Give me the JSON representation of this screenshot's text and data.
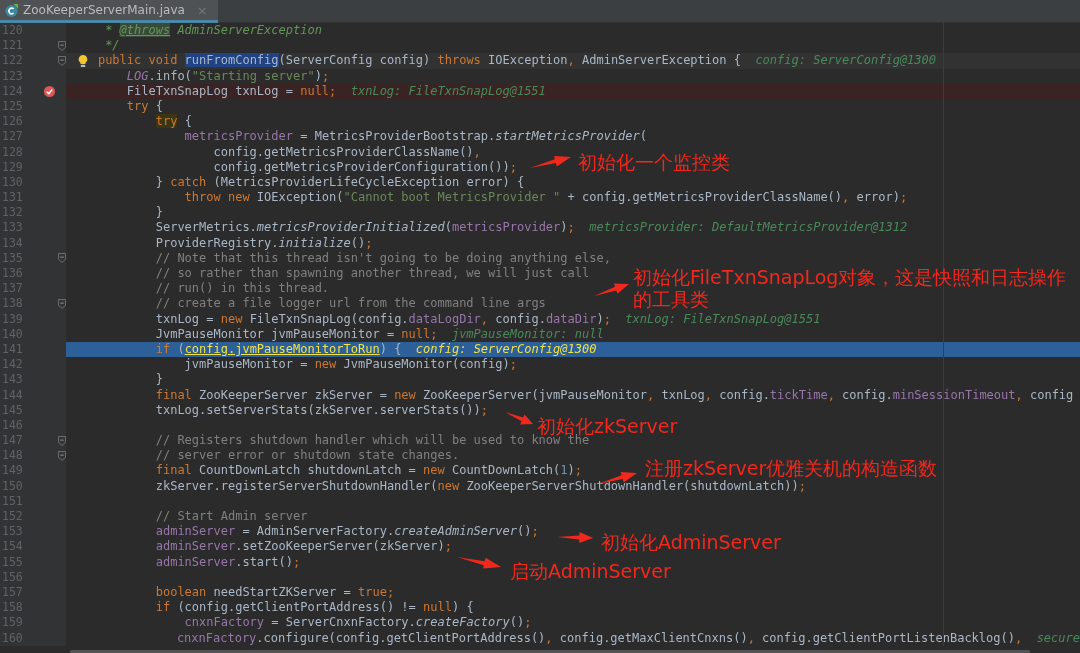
{
  "tabs": [
    {
      "label": "ZooKeeperServerMain.java",
      "close": "×",
      "selected": true
    }
  ],
  "lines": [
    {
      "number": "120",
      "tokens": [
        {
          "kind": "doc",
          "text": "     * "
        },
        {
          "kind": "doc_tag",
          "text": "@throws"
        },
        {
          "kind": "doc",
          "text": " AdminServerException"
        }
      ]
    },
    {
      "number": "121",
      "fold": true,
      "tokens": [
        {
          "kind": "doc",
          "text": "     */"
        }
      ]
    },
    {
      "number": "122",
      "fold": true,
      "caret_line": true,
      "intention_bulb": true,
      "tokens": [
        {
          "kind": "keyword",
          "text": "    public void "
        },
        {
          "kind": "match",
          "text": "runFromConfig"
        },
        {
          "kind": "plain",
          "text": "(ServerConfig config) "
        },
        {
          "kind": "keyword",
          "text": "throws "
        },
        {
          "kind": "plain",
          "text": "IOException"
        },
        {
          "kind": "keyword",
          "text": ", "
        },
        {
          "kind": "plain",
          "text": "AdminServerException {"
        }
      ],
      "hint": "config: ServerConfig@1300"
    },
    {
      "number": "123",
      "tokens": [
        {
          "kind": "static_field",
          "text": "        LOG"
        },
        {
          "kind": "plain",
          "text": ".info("
        },
        {
          "kind": "string",
          "text": "\"Starting server\""
        },
        {
          "kind": "plain",
          "text": ")"
        },
        {
          "kind": "keyword",
          "text": ";"
        }
      ]
    },
    {
      "number": "124",
      "breakpoint": true,
      "tokens": [
        {
          "kind": "plain",
          "text": "        FileTxnSnapLog txnLog = "
        },
        {
          "kind": "keyword",
          "text": "null;"
        }
      ],
      "hint": "txnLog: FileTxnSnapLog@1551"
    },
    {
      "number": "125",
      "tokens": [
        {
          "kind": "keyword",
          "text": "        try "
        },
        {
          "kind": "plain",
          "text": "{"
        }
      ]
    },
    {
      "number": "126",
      "tokens": [
        {
          "kind": "brace_match",
          "text": "            try"
        },
        {
          "kind": "plain",
          "text": " {"
        }
      ]
    },
    {
      "number": "127",
      "tokens": [
        {
          "kind": "field",
          "text": "                metricsProvider"
        },
        {
          "kind": "plain",
          "text": " = MetricsProviderBootstrap."
        },
        {
          "kind": "static",
          "text": "startMetricsProvider"
        },
        {
          "kind": "plain",
          "text": "("
        }
      ]
    },
    {
      "number": "128",
      "tokens": [
        {
          "kind": "plain",
          "text": "                    config.getMetricsProviderClassName()"
        },
        {
          "kind": "keyword",
          "text": ","
        }
      ]
    },
    {
      "number": "129",
      "tokens": [
        {
          "kind": "plain",
          "text": "                    config.getMetricsProviderConfiguration())"
        },
        {
          "kind": "keyword",
          "text": ";"
        }
      ]
    },
    {
      "number": "130",
      "tokens": [
        {
          "kind": "plain",
          "text": "            } "
        },
        {
          "kind": "keyword",
          "text": "catch "
        },
        {
          "kind": "plain",
          "text": "(MetricsProviderLifeCycleException error) {"
        }
      ]
    },
    {
      "number": "131",
      "tokens": [
        {
          "kind": "keyword",
          "text": "                throw new "
        },
        {
          "kind": "plain",
          "text": "IOException("
        },
        {
          "kind": "string",
          "text": "\"Cannot boot MetricsProvider \""
        },
        {
          "kind": "plain",
          "text": " + config.getMetricsProviderClassName()"
        },
        {
          "kind": "keyword",
          "text": ", "
        },
        {
          "kind": "plain",
          "text": "error)"
        },
        {
          "kind": "keyword",
          "text": ";"
        }
      ]
    },
    {
      "number": "132",
      "tokens": [
        {
          "kind": "plain",
          "text": "            }"
        }
      ]
    },
    {
      "number": "133",
      "tokens": [
        {
          "kind": "plain",
          "text": "            ServerMetrics."
        },
        {
          "kind": "static",
          "text": "metricsProviderInitialized"
        },
        {
          "kind": "plain",
          "text": "("
        },
        {
          "kind": "field",
          "text": "metricsProvider"
        },
        {
          "kind": "plain",
          "text": ")"
        },
        {
          "kind": "keyword",
          "text": ";"
        }
      ],
      "hint": "metricsProvider: DefaultMetricsProvider@1312"
    },
    {
      "number": "134",
      "tokens": [
        {
          "kind": "plain",
          "text": "            ProviderRegistry."
        },
        {
          "kind": "static",
          "text": "initialize"
        },
        {
          "kind": "plain",
          "text": "()"
        },
        {
          "kind": "keyword",
          "text": ";"
        }
      ]
    },
    {
      "number": "135",
      "fold": true,
      "tokens": [
        {
          "kind": "comment",
          "text": "            // Note that this thread isn't going to be doing anything else,"
        }
      ]
    },
    {
      "number": "136",
      "tokens": [
        {
          "kind": "comment",
          "text": "            // so rather than spawning another thread, we will just call"
        }
      ]
    },
    {
      "number": "137",
      "tokens": [
        {
          "kind": "comment",
          "text": "            // run() in this thread."
        }
      ]
    },
    {
      "number": "138",
      "fold": true,
      "tokens": [
        {
          "kind": "comment",
          "text": "            // create a file logger url from the command line args"
        }
      ]
    },
    {
      "number": "139",
      "tokens": [
        {
          "kind": "plain",
          "text": "            txnLog = "
        },
        {
          "kind": "keyword",
          "text": "new "
        },
        {
          "kind": "plain",
          "text": "FileTxnSnapLog(config."
        },
        {
          "kind": "field",
          "text": "dataLogDir"
        },
        {
          "kind": "keyword",
          "text": ", "
        },
        {
          "kind": "plain",
          "text": "config."
        },
        {
          "kind": "field",
          "text": "dataDir"
        },
        {
          "kind": "plain",
          "text": ")"
        },
        {
          "kind": "keyword",
          "text": ";"
        }
      ],
      "hint": "txnLog: FileTxnSnapLog@1551"
    },
    {
      "number": "140",
      "tokens": [
        {
          "kind": "plain",
          "text": "            JvmPauseMonitor jvmPauseMonitor = "
        },
        {
          "kind": "keyword",
          "text": "null;"
        }
      ],
      "hint": "jvmPauseMonitor: null"
    },
    {
      "number": "141",
      "execution_point": true,
      "tokens": [
        {
          "kind": "keyword",
          "text": "            if "
        },
        {
          "kind": "plain",
          "text": "("
        },
        {
          "kind": "watch",
          "text": "config.jvmPauseMonitorToRun"
        },
        {
          "kind": "plain",
          "text": ") {"
        }
      ],
      "hint": "config: ServerConfig@1300"
    },
    {
      "number": "142",
      "tokens": [
        {
          "kind": "plain",
          "text": "                jvmPauseMonitor = "
        },
        {
          "kind": "keyword",
          "text": "new "
        },
        {
          "kind": "plain",
          "text": "JvmPauseMonitor(config)"
        },
        {
          "kind": "keyword",
          "text": ";"
        }
      ]
    },
    {
      "number": "143",
      "tokens": [
        {
          "kind": "plain",
          "text": "            }"
        }
      ]
    },
    {
      "number": "144",
      "tokens": [
        {
          "kind": "keyword",
          "text": "            final "
        },
        {
          "kind": "plain",
          "text": "ZooKeeperServer zkServer = "
        },
        {
          "kind": "keyword",
          "text": "new "
        },
        {
          "kind": "plain",
          "text": "ZooKeeperServer(jvmPauseMonitor"
        },
        {
          "kind": "keyword",
          "text": ", "
        },
        {
          "kind": "plain",
          "text": "txnLog"
        },
        {
          "kind": "keyword",
          "text": ", "
        },
        {
          "kind": "plain",
          "text": "config."
        },
        {
          "kind": "field",
          "text": "tickTime"
        },
        {
          "kind": "keyword",
          "text": ", "
        },
        {
          "kind": "plain",
          "text": "config."
        },
        {
          "kind": "field",
          "text": "minSessionTimeout"
        },
        {
          "kind": "keyword",
          "text": ", "
        },
        {
          "kind": "plain",
          "text": "config"
        }
      ]
    },
    {
      "number": "145",
      "tokens": [
        {
          "kind": "plain",
          "text": "            txnLog.setServerStats(zkServer.serverStats())"
        },
        {
          "kind": "keyword",
          "text": ";"
        }
      ]
    },
    {
      "number": "146"
    },
    {
      "number": "147",
      "fold": true,
      "tokens": [
        {
          "kind": "comment",
          "text": "            // Registers shutdown handler which will be used to know the"
        }
      ]
    },
    {
      "number": "148",
      "fold": true,
      "tokens": [
        {
          "kind": "comment",
          "text": "            // server error or shutdown state changes."
        }
      ]
    },
    {
      "number": "149",
      "tokens": [
        {
          "kind": "keyword",
          "text": "            final "
        },
        {
          "kind": "plain",
          "text": "CountDownLatch shutdownLatch = "
        },
        {
          "kind": "keyword",
          "text": "new "
        },
        {
          "kind": "plain",
          "text": "CountDownLatch("
        },
        {
          "kind": "number",
          "text": "1"
        },
        {
          "kind": "plain",
          "text": ")"
        },
        {
          "kind": "keyword",
          "text": ";"
        }
      ]
    },
    {
      "number": "150",
      "tokens": [
        {
          "kind": "plain",
          "text": "            zkServer.registerServerShutdownHandler("
        },
        {
          "kind": "keyword",
          "text": "new "
        },
        {
          "kind": "plain",
          "text": "ZooKeeperServerShutdownHandler(shutdownLatch))"
        },
        {
          "kind": "keyword",
          "text": ";"
        }
      ]
    },
    {
      "number": "151"
    },
    {
      "number": "152",
      "tokens": [
        {
          "kind": "comment",
          "text": "            // Start Admin server"
        }
      ]
    },
    {
      "number": "153",
      "tokens": [
        {
          "kind": "field",
          "text": "            adminServer"
        },
        {
          "kind": "plain",
          "text": " = AdminServerFactory."
        },
        {
          "kind": "static",
          "text": "createAdminServer"
        },
        {
          "kind": "plain",
          "text": "()"
        },
        {
          "kind": "keyword",
          "text": ";"
        }
      ]
    },
    {
      "number": "154",
      "tokens": [
        {
          "kind": "field",
          "text": "            adminServer"
        },
        {
          "kind": "plain",
          "text": ".setZooKeeperServer(zkServer)"
        },
        {
          "kind": "keyword",
          "text": ";"
        }
      ]
    },
    {
      "number": "155",
      "tokens": [
        {
          "kind": "field",
          "text": "            adminServer"
        },
        {
          "kind": "plain",
          "text": ".start()"
        },
        {
          "kind": "keyword",
          "text": ";"
        }
      ]
    },
    {
      "number": "156"
    },
    {
      "number": "157",
      "tokens": [
        {
          "kind": "keyword",
          "text": "            boolean "
        },
        {
          "kind": "plain",
          "text": "needStartZKServer = "
        },
        {
          "kind": "keyword",
          "text": "true;"
        }
      ]
    },
    {
      "number": "158",
      "tokens": [
        {
          "kind": "keyword",
          "text": "            if "
        },
        {
          "kind": "plain",
          "text": "(config.getClientPortAddress() != "
        },
        {
          "kind": "keyword",
          "text": "null"
        },
        {
          "kind": "plain",
          "text": ") {"
        }
      ]
    },
    {
      "number": "159",
      "tokens": [
        {
          "kind": "field",
          "text": "                cnxnFactory"
        },
        {
          "kind": "plain",
          "text": " = ServerCnxnFactory."
        },
        {
          "kind": "static",
          "text": "createFactory"
        },
        {
          "kind": "plain",
          "text": "()"
        },
        {
          "kind": "keyword",
          "text": ";"
        }
      ]
    },
    {
      "number": "160",
      "tokens": [
        {
          "kind": "field",
          "text": "                cnxnFactory"
        },
        {
          "kind": "plain",
          "text": ".configure(config.getClientPortAddress()"
        },
        {
          "kind": "keyword",
          "text": ", "
        },
        {
          "kind": "plain",
          "text": "config.getMaxClientCnxns()"
        },
        {
          "kind": "keyword",
          "text": ", "
        },
        {
          "kind": "plain",
          "text": "config.getClientPortListenBacklog()"
        },
        {
          "kind": "keyword",
          "text": ","
        }
      ],
      "hint": "secure"
    }
  ],
  "annotations": [
    {
      "text": "初始化一个监控类"
    },
    {
      "text": "初始化FileTxnSnapLog对象，这是快照和日志操作的工具类"
    },
    {
      "text": "初始化zkServer"
    },
    {
      "text": "注册zkServer优雅关机的构造函数"
    },
    {
      "text": "初始化AdminServer"
    },
    {
      "text": "启动AdminServer"
    }
  ]
}
